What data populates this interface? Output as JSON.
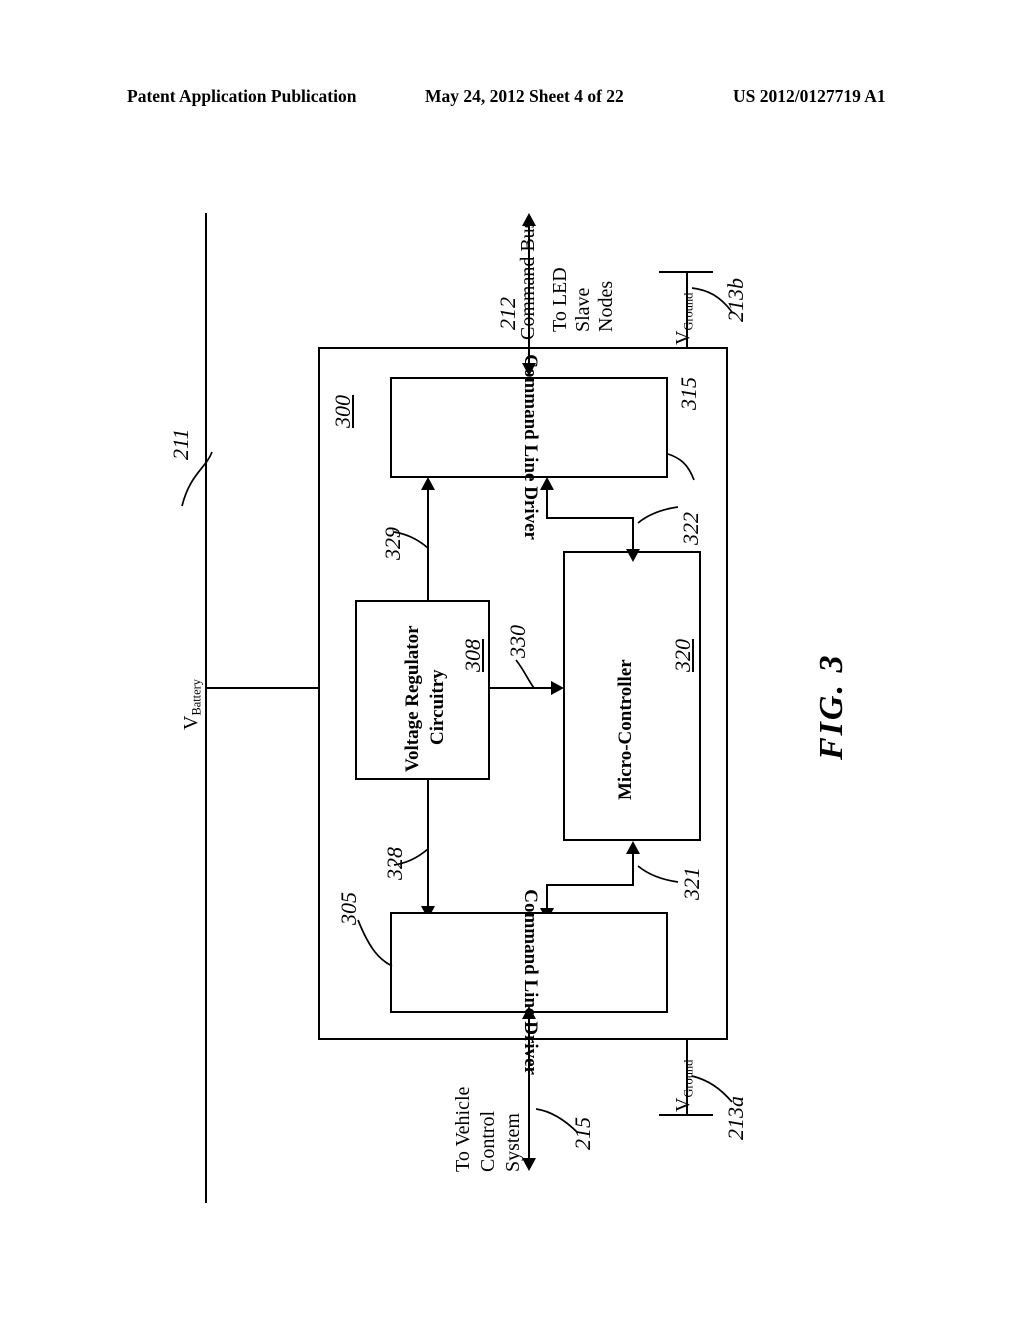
{
  "header": {
    "publication": "Patent Application Publication",
    "date_sheet": "May 24, 2012  Sheet 4 of 22",
    "document_number": "US 2012/0127719 A1"
  },
  "figure": {
    "caption": "FIG.  3",
    "assembly_ref": "300"
  },
  "blocks": [
    {
      "id": "command-line-driver-top",
      "label": "Command Line Driver",
      "ref": "315"
    },
    {
      "id": "voltage-regulator",
      "label_line1": "Voltage Regulator",
      "label_line2": "Circuitry",
      "ref": "308"
    },
    {
      "id": "micro-controller",
      "label": "Micro-Controller",
      "ref": "320"
    },
    {
      "id": "command-line-driver-bottom",
      "label": "Command Line Driver",
      "ref": "305"
    }
  ],
  "signals": {
    "battery_rail": "211",
    "battery_label_v": "V",
    "battery_label_sub": "Battery",
    "command_bus_ref": "212",
    "command_bus_label": "Command Bus",
    "to_led_line1": "To LED",
    "to_led_line2": "Slave",
    "to_led_line3": "Nodes",
    "vehicle_bus_ref": "215",
    "to_vehicle_line1": "To Vehicle",
    "to_vehicle_line2": "Control",
    "to_vehicle_line3": "System",
    "ground_label_v": "V",
    "ground_label_sub": "Ground",
    "ground_top_ref": "213b",
    "ground_bottom_ref": "213a",
    "interconnect_328": "328",
    "interconnect_329": "329",
    "interconnect_330": "330",
    "interconnect_321": "321",
    "interconnect_322": "322"
  },
  "diagram_description": {
    "orientation": "rotated 90 degrees counter-clockwise on page",
    "type": "block-diagram"
  }
}
